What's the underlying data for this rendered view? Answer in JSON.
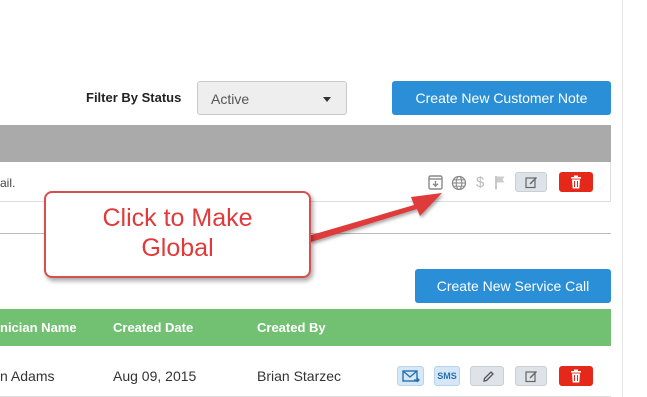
{
  "filter": {
    "label": "Filter By Status",
    "selected": "Active"
  },
  "notes": {
    "create_button_label": "Create New Customer Note",
    "row_text": "ail.",
    "row_icons": [
      "download-icon",
      "globe-icon",
      "dollar-icon",
      "flag-icon",
      "edit-icon",
      "trash-icon"
    ],
    "dollar_glyph": "$"
  },
  "callout": {
    "line1": "Click to Make",
    "line2": "Global"
  },
  "service_calls": {
    "create_button_label": "Create New Service Call",
    "columns": [
      "nician Name",
      "Created Date",
      "Created By"
    ],
    "row": {
      "technician": "n Adams",
      "created_date": "Aug 09, 2015",
      "created_by": "Brian Starzec",
      "sms_label": "SMS"
    }
  },
  "colors": {
    "primary_button": "#2a8fd6",
    "notes_header": "#aaaaaa",
    "calls_header": "#72c172",
    "danger": "#e6281a",
    "callout": "#d45050"
  }
}
